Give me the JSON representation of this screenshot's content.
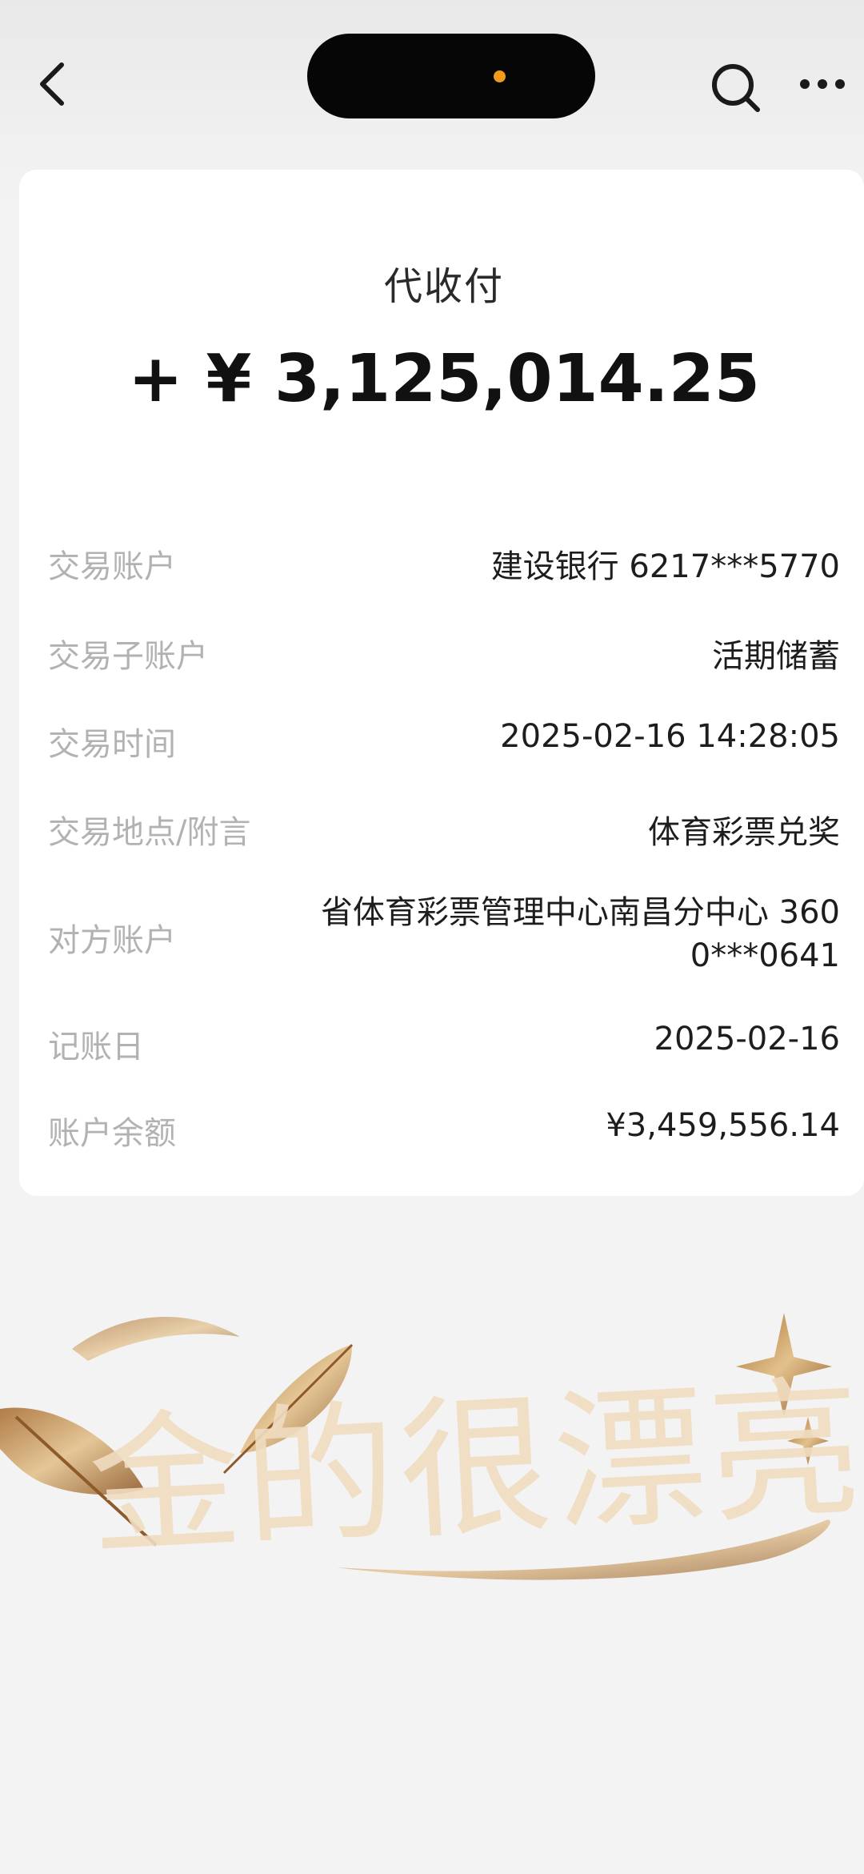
{
  "nav": {
    "back_icon": "chevron-left-icon",
    "search_icon": "search-icon",
    "more_icon": "more-horizontal-icon"
  },
  "card": {
    "title": "代收付",
    "amount": "+ ¥ 3,125,014.25",
    "rows": [
      {
        "label": "交易账户",
        "value": "建设银行 6217***5770"
      },
      {
        "label": "交易子账户",
        "value": "活期储蓄"
      },
      {
        "label": "交易时间",
        "value": "2025-02-16 14:28:05"
      },
      {
        "label": "交易地点/附言",
        "value": "体育彩票兑奖"
      },
      {
        "label": "对方账户",
        "value_line1": "省体育彩票管理中心南昌分中心 360",
        "value_line2": "0***0641"
      },
      {
        "label": "记账日",
        "value": "2025-02-16"
      },
      {
        "label": "账户余额",
        "value": "¥3,459,556.14"
      }
    ]
  },
  "decoration": {
    "text": "金的很漂亮",
    "accent_color": "#d4a66a",
    "light_color": "#f0dcc1"
  },
  "colors": {
    "background": "#f3f3f3",
    "card": "#ffffff",
    "label": "#b2b2b2",
    "value": "#1d1d1d",
    "island_dot": "#f29a1c"
  }
}
